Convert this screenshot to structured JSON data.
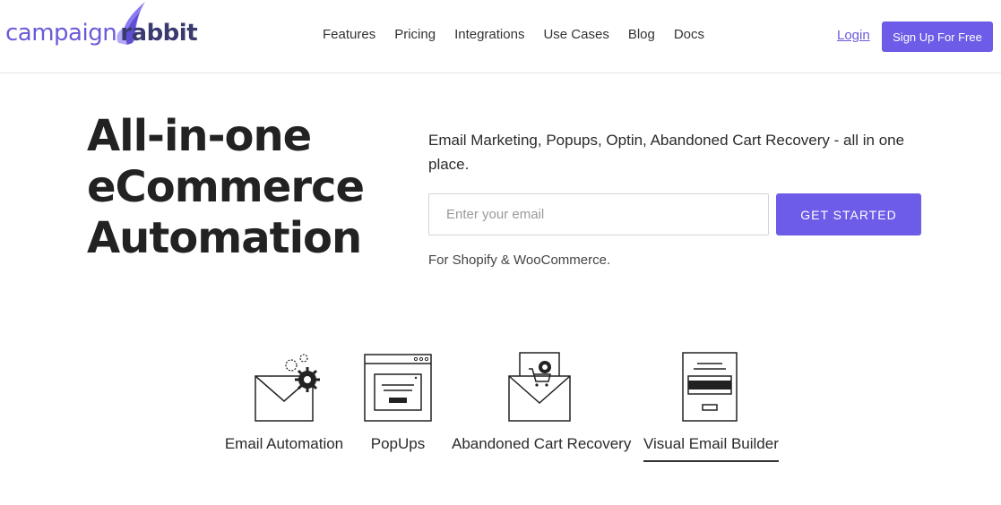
{
  "header": {
    "logo_part1": "campaign",
    "logo_part2": "rabbit",
    "nav": [
      "Features",
      "Pricing",
      "Integrations",
      "Use Cases",
      "Blog",
      "Docs"
    ],
    "login_label": "Login",
    "signup_label": "Sign Up For Free"
  },
  "hero": {
    "title_line1": "All-in-one",
    "title_line2": "eCommerce",
    "title_line3": "Automation",
    "description": "Email Marketing, Popups, Optin, Abandoned Cart Recovery - all in one place.",
    "email_placeholder": "Enter your email",
    "email_value": "",
    "cta_label": "GET STARTED",
    "platforms_note": "For Shopify & WooCommerce."
  },
  "features": {
    "items": [
      {
        "label": "Email Automation",
        "icon": "envelope-gears-icon"
      },
      {
        "label": "PopUps",
        "icon": "browser-popup-icon"
      },
      {
        "label": "Abandoned Cart Recovery",
        "icon": "envelope-cart-icon"
      },
      {
        "label": "Visual Email Builder",
        "icon": "email-layout-icon"
      }
    ],
    "active_index": 3
  },
  "colors": {
    "accent": "#6c5ce7",
    "logo_light": "#6a5bd8",
    "logo_dark": "#3b3a70"
  }
}
